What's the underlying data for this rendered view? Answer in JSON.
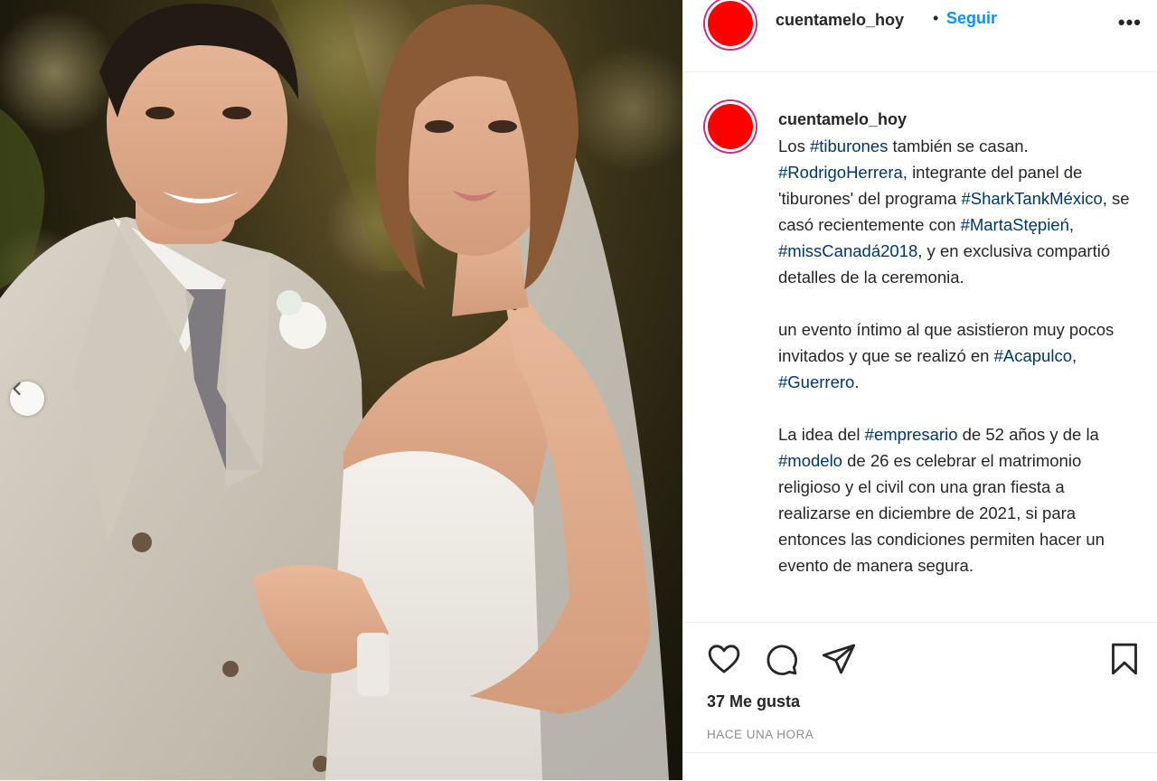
{
  "post": {
    "username": "cuentamelo_hoy",
    "separator": "•",
    "follow_label": "Seguir",
    "more_icon": "more-options-icon",
    "avatar_color": "#ff0000",
    "link_color": "#00376b",
    "follow_color": "#0095f6"
  },
  "caption": {
    "username": "cuentamelo_hoy",
    "p1": [
      {
        "t": "Los ",
        "tag": false
      },
      {
        "t": "#tiburones",
        "tag": true
      },
      {
        "t": " también se casan. ",
        "tag": false
      },
      {
        "t": "#RodrigoHerrera",
        "tag": true
      },
      {
        "t": ", integrante del panel de 'tiburones' del programa ",
        "tag": false
      },
      {
        "t": "#SharkTankMéxico",
        "tag": true
      },
      {
        "t": ", se casó recientemente con ",
        "tag": false
      },
      {
        "t": "#MartaStępień",
        "tag": true
      },
      {
        "t": ", ",
        "tag": false
      },
      {
        "t": "#missCanadá2018",
        "tag": true
      },
      {
        "t": ", y en exclusiva compartió detalles de la ceremonia.",
        "tag": false
      }
    ],
    "p2": [
      {
        "t": "un evento íntimo al que asistieron muy pocos invitados y que se realizó en ",
        "tag": false
      },
      {
        "t": "#Acapulco",
        "tag": true
      },
      {
        "t": ", ",
        "tag": false
      },
      {
        "t": "#Guerrero",
        "tag": true
      },
      {
        "t": ".",
        "tag": false
      }
    ],
    "p3": [
      {
        "t": "La idea del ",
        "tag": false
      },
      {
        "t": "#empresario",
        "tag": true
      },
      {
        "t": " de 52 años y de la ",
        "tag": false
      },
      {
        "t": "#modelo",
        "tag": true
      },
      {
        "t": " de 26 es celebrar el matrimonio religioso y el civil con una gran fiesta a realizarse en diciembre de 2021, si para entonces las condiciones permiten hacer un evento de manera segura.",
        "tag": false
      }
    ]
  },
  "actions": {
    "like_icon": "heart-icon",
    "comment_icon": "comment-icon",
    "share_icon": "share-icon",
    "save_icon": "bookmark-icon",
    "likes_text": "37 Me gusta",
    "timestamp": "HACE UNA HORA"
  },
  "media": {
    "description_icon": "wedding-photo",
    "prev_icon": "chevron-left-icon"
  }
}
